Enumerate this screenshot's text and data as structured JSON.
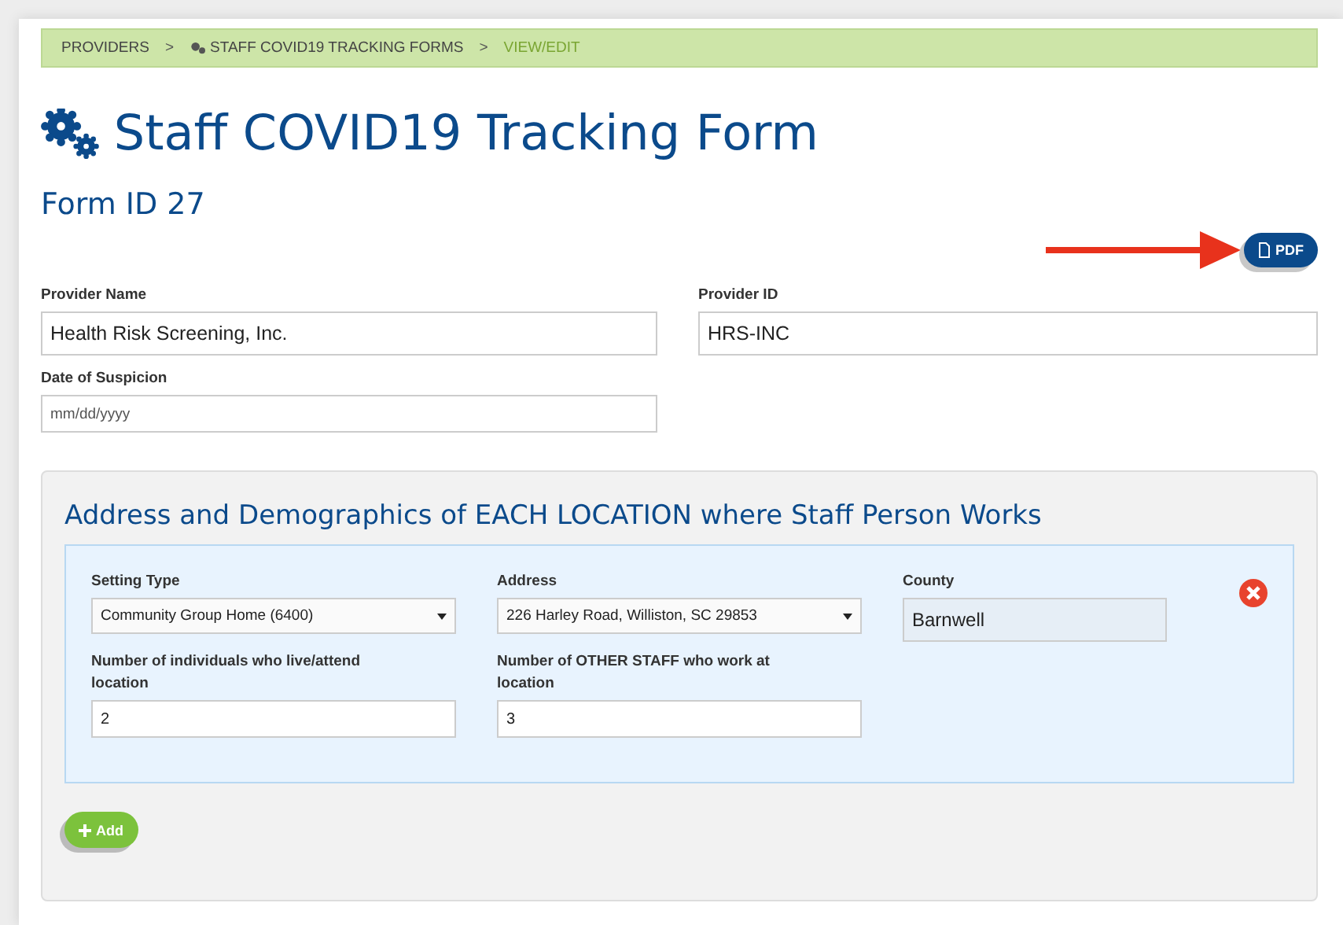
{
  "breadcrumb": [
    {
      "label": "PROVIDERS",
      "icon": false,
      "current": false
    },
    {
      "label": "STAFF COVID19 TRACKING FORMS",
      "icon": true,
      "current": false
    },
    {
      "label": "VIEW/EDIT",
      "icon": false,
      "current": true
    }
  ],
  "breadcrumb_separator": ">",
  "title": "Staff COVID19 Tracking Form",
  "form_id": "Form ID 27",
  "pdf_button": "PDF",
  "fields": [
    {
      "label": "Provider Name",
      "value": "Health Risk Screening, Inc.",
      "kind": "input"
    },
    {
      "label": "Provider ID",
      "value": "HRS-INC",
      "kind": "input"
    },
    {
      "label": "Date of Suspicion",
      "placeholder": "mm/dd/yyyy",
      "kind": "date"
    }
  ],
  "locations_section": {
    "title": "Address and Demographics of EACH LOCATION where Staff Person Works",
    "locations": [
      {
        "fields": [
          {
            "label": "Setting Type",
            "value": "Community Group Home (6400)",
            "kind": "select"
          },
          {
            "label": "Address",
            "value": "226 Harley Road, Williston, SC 29853",
            "kind": "select"
          },
          {
            "label": "County",
            "value": "Barnwell",
            "kind": "readonly"
          },
          {
            "label": "Number of individuals who live/attend location",
            "value": "2",
            "kind": "input"
          },
          {
            "label": "Number of OTHER STAFF who work at location",
            "value": "3",
            "kind": "input"
          }
        ]
      }
    ],
    "add_button": "Add"
  }
}
